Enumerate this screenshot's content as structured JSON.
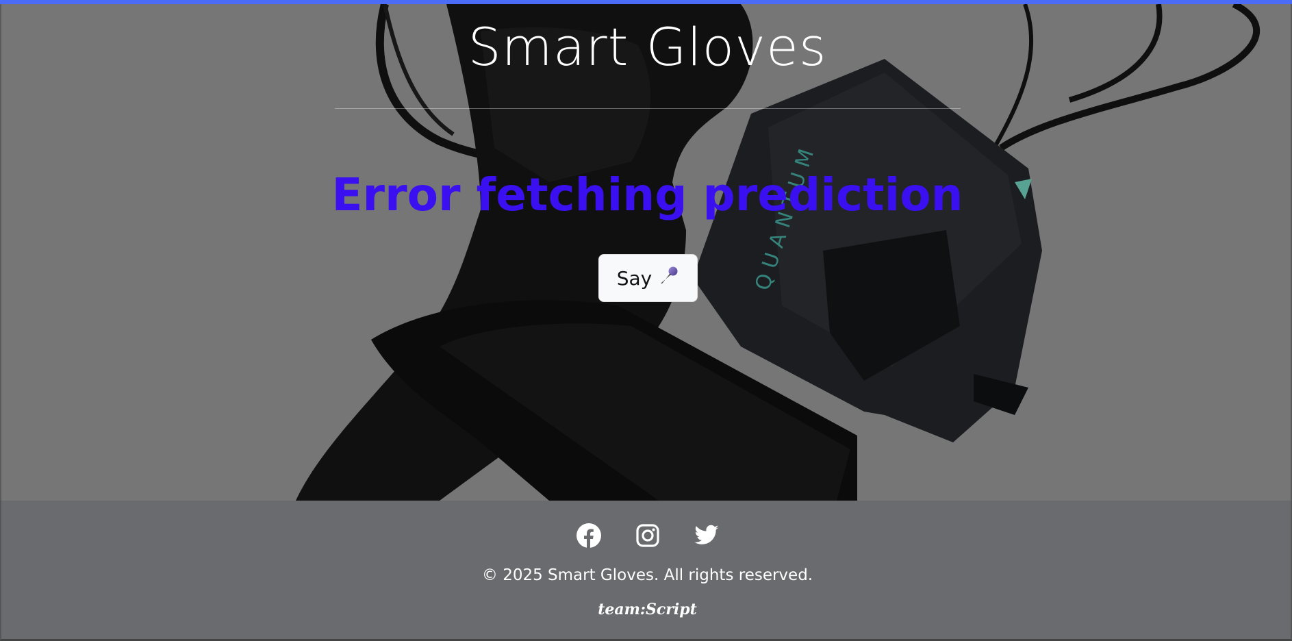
{
  "header": {
    "title": "Smart Gloves"
  },
  "main": {
    "message": "Error fetching prediction",
    "say_button": {
      "label": "Say",
      "icon": "microphone-icon"
    }
  },
  "footer": {
    "social_icons": [
      "facebook-icon",
      "instagram-icon",
      "twitter-icon"
    ],
    "copyright": "© 2025 Smart Gloves. All rights reserved.",
    "team": "team:Script"
  },
  "colors": {
    "accent_bar": "#4a6cf7",
    "message": "#3a10f0",
    "hero_background": "#808080",
    "footer_background": "#6a6b6e"
  }
}
